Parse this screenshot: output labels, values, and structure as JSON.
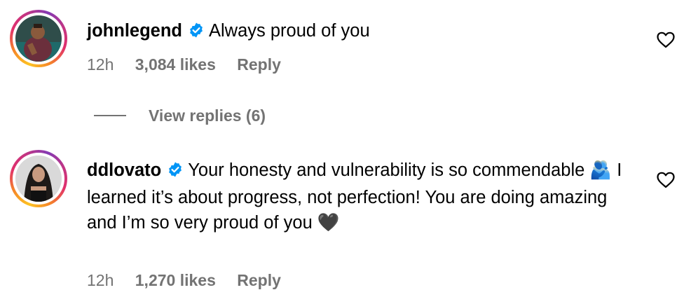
{
  "comments": [
    {
      "username": "johnlegend",
      "verified": true,
      "text": "Always proud of you",
      "time": "12h",
      "likes": "3,084 likes",
      "reply_label": "Reply",
      "avatar_icon": "avatar-photo-johnlegend",
      "like_icon": "heart-outline-icon"
    },
    {
      "username": "ddlovato",
      "verified": true,
      "text_part1": "Your honesty and vulnerability is so commendable",
      "emoji1": "🫂",
      "text_part2": "I learned it’s about progress, not perfection! You are doing amazing and I’m so very proud of you",
      "emoji2": "🖤",
      "time": "12h",
      "likes": "1,270 likes",
      "reply_label": "Reply",
      "avatar_icon": "avatar-photo-ddlovato",
      "like_icon": "heart-outline-icon"
    }
  ],
  "view_replies": {
    "label": "View replies (6)"
  },
  "colors": {
    "verified_blue": "#0095f6",
    "secondary_text": "#737373"
  }
}
